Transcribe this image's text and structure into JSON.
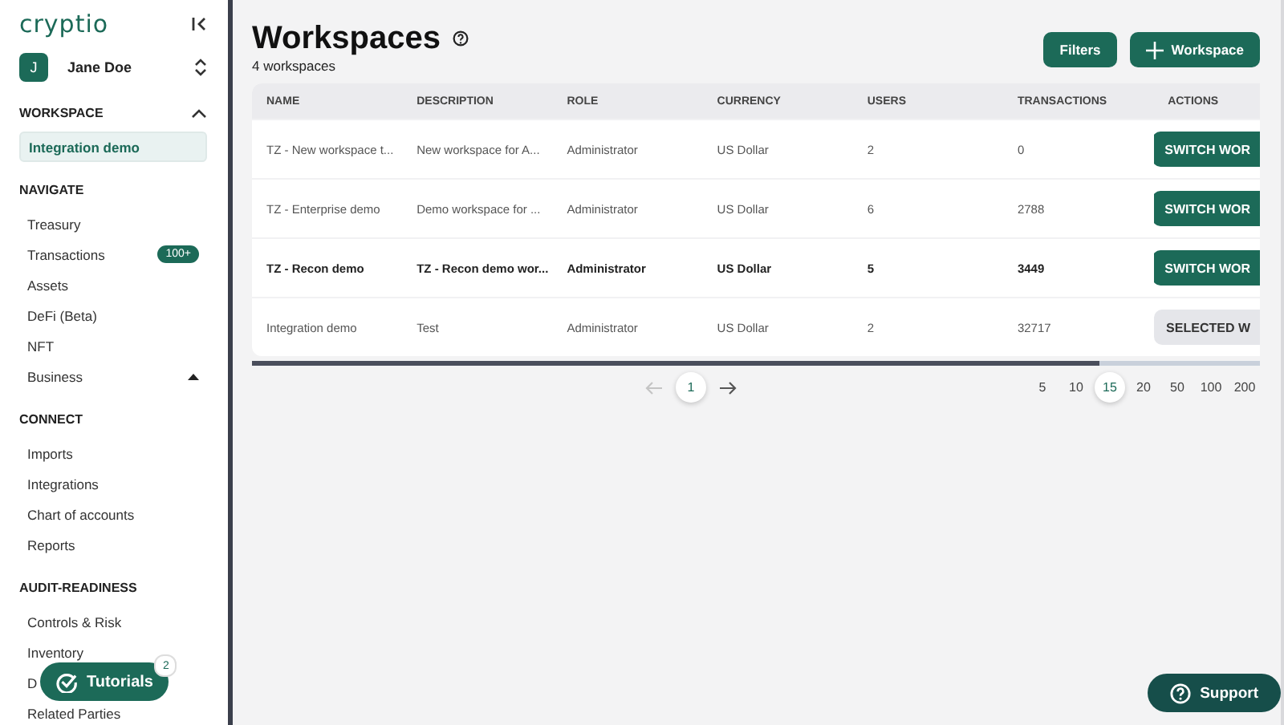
{
  "sidebar": {
    "logo": "cryptio",
    "user": {
      "initial": "J",
      "name": "Jane Doe"
    },
    "sections": [
      {
        "title": "WORKSPACE",
        "expanded": true,
        "items": [
          {
            "label": "Integration demo",
            "selected": true
          }
        ]
      },
      {
        "title": "NAVIGATE",
        "items": [
          {
            "label": "Treasury",
            "selected": false
          },
          {
            "label": "Transactions",
            "selected": false,
            "badge": "100+"
          },
          {
            "label": "Assets",
            "selected": false
          },
          {
            "label": "DeFi (Beta)",
            "selected": false
          },
          {
            "label": "NFT",
            "selected": false
          },
          {
            "label": "Business",
            "selected": false,
            "expanded": true
          }
        ]
      },
      {
        "title": "CONNECT",
        "items": [
          {
            "label": "Imports",
            "selected": false
          },
          {
            "label": "Integrations",
            "selected": false
          },
          {
            "label": "Chart of accounts",
            "selected": false
          },
          {
            "label": "Reports",
            "selected": false
          }
        ]
      },
      {
        "title": "AUDIT-READINESS",
        "items": [
          {
            "label": "Controls & Risk",
            "selected": false
          },
          {
            "label": "Inventory",
            "selected": false
          },
          {
            "label": "D",
            "selected": false
          },
          {
            "label": "Related Parties",
            "selected": false
          }
        ]
      }
    ]
  },
  "tutorials": {
    "label": "Tutorials",
    "count": "2"
  },
  "header": {
    "title": "Workspaces",
    "subtitle": "4 workspaces",
    "buttons": [
      {
        "label": "Filters",
        "kind": "plain"
      },
      {
        "label": "Workspace",
        "kind": "add"
      }
    ]
  },
  "table": {
    "columns": [
      "NAME",
      "DESCRIPTION",
      "ROLE",
      "CURRENCY",
      "USERS",
      "TRANSACTIONS",
      "ACTIONS"
    ],
    "rows": [
      {
        "cells": [
          "TZ - New workspace t...",
          "New workspace for A...",
          "Administrator",
          "US Dollar",
          "2",
          "0"
        ],
        "action": "SWITCH WOR",
        "selected": false,
        "hovered": false
      },
      {
        "cells": [
          "TZ - Enterprise demo",
          "Demo workspace for ...",
          "Administrator",
          "US Dollar",
          "6",
          "2788"
        ],
        "action": "SWITCH WOR",
        "selected": false,
        "hovered": false
      },
      {
        "cells": [
          "TZ - Recon demo",
          "TZ - Recon demo wor...",
          "Administrator",
          "US Dollar",
          "5",
          "3449"
        ],
        "action": "SWITCH WOR",
        "selected": false,
        "hovered": true
      },
      {
        "cells": [
          "Integration demo",
          "Test",
          "Administrator",
          "US Dollar",
          "2",
          "32717"
        ],
        "action": "SELECTED W",
        "selected": true,
        "hovered": false
      }
    ]
  },
  "pagination": {
    "pages": [
      {
        "label": "1",
        "selected": true
      }
    ],
    "prev_disabled": true,
    "next_disabled": false,
    "page_sizes": [
      {
        "label": "5",
        "selected": false
      },
      {
        "label": "10",
        "selected": false
      },
      {
        "label": "15",
        "selected": true
      },
      {
        "label": "20",
        "selected": false
      },
      {
        "label": "50",
        "selected": false
      },
      {
        "label": "100",
        "selected": false
      },
      {
        "label": "200",
        "selected": false
      }
    ]
  },
  "support": {
    "label": "Support"
  }
}
